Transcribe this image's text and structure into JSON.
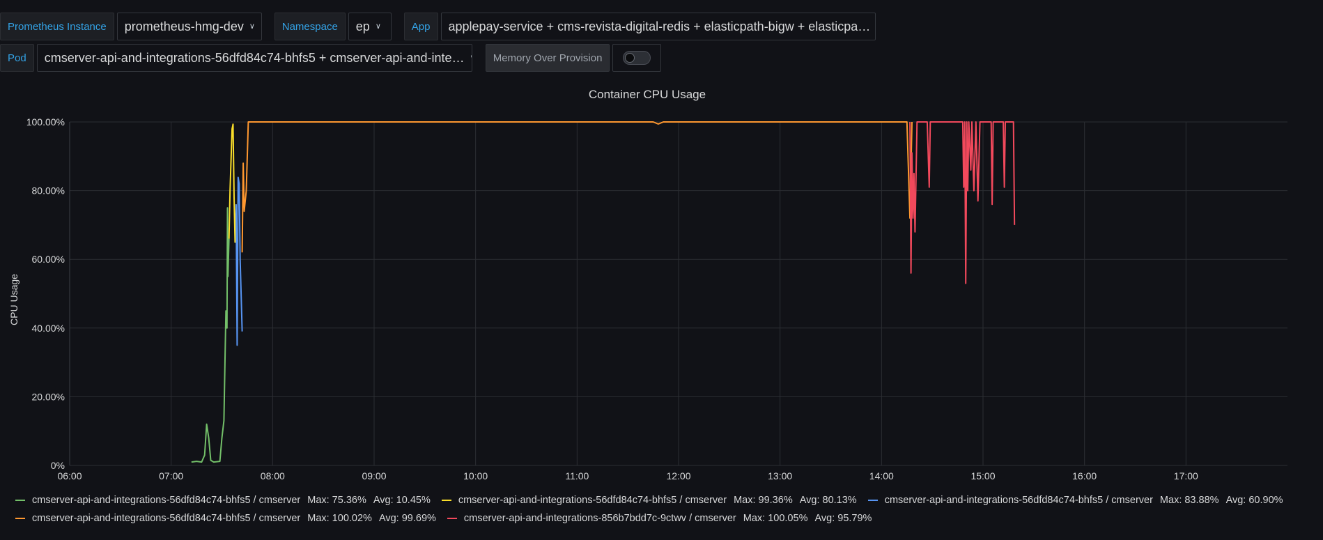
{
  "variables": {
    "prometheus": {
      "label": "Prometheus Instance",
      "value": "prometheus-hmg-dev"
    },
    "namespace": {
      "label": "Namespace",
      "value": "ep"
    },
    "app": {
      "label": "App",
      "value": "applepay-service + cms-revista-digital-redis + elasticpath-bigw + elasticpa…"
    },
    "pod": {
      "label": "Pod",
      "value": "cmserver-api-and-integrations-56dfd84c74-bhfs5 + cmserver-api-and-inte…"
    },
    "memory_over_provision": {
      "label": "Memory Over Provision",
      "enabled": false
    }
  },
  "icons": {
    "dropdown": "chevron-down-icon"
  },
  "chart_data": {
    "type": "line",
    "title": "Container CPU Usage",
    "ylabel": "CPU Usage",
    "xlabel": "",
    "x_unit": "hours (time of day)",
    "xlim": [
      6.0,
      18.0
    ],
    "ylim": [
      0,
      100
    ],
    "x_ticks": [
      "06:00",
      "07:00",
      "08:00",
      "09:00",
      "10:00",
      "11:00",
      "12:00",
      "13:00",
      "14:00",
      "15:00",
      "16:00",
      "17:00"
    ],
    "y_ticks": [
      "0%",
      "20.00%",
      "40.00%",
      "60.00%",
      "80.00%",
      "100.00%"
    ],
    "grid": true,
    "legend_placement": "bottom",
    "series": [
      {
        "name": "cmserver-api-and-integrations-56dfd84c74-bhfs5 / cmserver",
        "max": "Max: 75.36%",
        "avg": "Avg: 10.45%",
        "color": "#73bf69",
        "points": [
          [
            7.2,
            1
          ],
          [
            7.25,
            1.2
          ],
          [
            7.3,
            1
          ],
          [
            7.33,
            3
          ],
          [
            7.35,
            12
          ],
          [
            7.37,
            8
          ],
          [
            7.39,
            1.5
          ],
          [
            7.42,
            1
          ],
          [
            7.48,
            1.2
          ],
          [
            7.5,
            8
          ],
          [
            7.52,
            13
          ],
          [
            7.53,
            30
          ],
          [
            7.54,
            45
          ],
          [
            7.55,
            40
          ],
          [
            7.555,
            75
          ],
          [
            7.56,
            55
          ],
          [
            7.57,
            66
          ]
        ]
      },
      {
        "name": "cmserver-api-and-integrations-56dfd84c74-bhfs5 / cmserver",
        "max": "Max: 99.36%",
        "avg": "Avg: 80.13%",
        "color": "#fade2a",
        "points": [
          [
            7.57,
            66
          ],
          [
            7.58,
            80
          ],
          [
            7.6,
            98
          ],
          [
            7.61,
            99.36
          ],
          [
            7.62,
            78
          ],
          [
            7.63,
            65
          ],
          [
            7.64,
            76
          ]
        ]
      },
      {
        "name": "cmserver-api-and-integrations-56dfd84c74-bhfs5 / cmserver",
        "max": "Max: 83.88%",
        "avg": "Avg: 60.90%",
        "color": "#5794f2",
        "points": [
          [
            7.64,
            76
          ],
          [
            7.65,
            35
          ],
          [
            7.66,
            83.88
          ],
          [
            7.67,
            82
          ],
          [
            7.68,
            60
          ],
          [
            7.7,
            39
          ]
        ]
      },
      {
        "name": "cmserver-api-and-integrations-56dfd84c74-bhfs5 / cmserver",
        "max": "Max: 100.02%",
        "avg": "Avg: 99.69%",
        "color": "#ff9830",
        "points": [
          [
            7.7,
            62
          ],
          [
            7.71,
            88
          ],
          [
            7.72,
            74
          ],
          [
            7.74,
            80
          ],
          [
            7.76,
            100
          ],
          [
            8.0,
            100
          ],
          [
            10.0,
            100
          ],
          [
            11.0,
            100
          ],
          [
            11.75,
            100
          ],
          [
            11.8,
            99.4
          ],
          [
            11.85,
            100
          ],
          [
            13.0,
            100
          ],
          [
            14.0,
            100
          ],
          [
            14.25,
            100
          ],
          [
            14.28,
            72
          ],
          [
            14.3,
            100
          ]
        ]
      },
      {
        "name": "cmserver-api-and-integrations-856b7bdd7c-9ctwv / cmserver",
        "max": "Max: 100.05%",
        "avg": "Avg: 95.79%",
        "color": "#f2495c",
        "points": [
          [
            14.28,
            100
          ],
          [
            14.29,
            56
          ],
          [
            14.3,
            91
          ],
          [
            14.31,
            72
          ],
          [
            14.32,
            85
          ],
          [
            14.33,
            68
          ],
          [
            14.35,
            100
          ],
          [
            14.45,
            100
          ],
          [
            14.47,
            81
          ],
          [
            14.48,
            100
          ],
          [
            14.8,
            100
          ],
          [
            14.81,
            81
          ],
          [
            14.82,
            100
          ],
          [
            14.83,
            53
          ],
          [
            14.84,
            100
          ],
          [
            14.85,
            80
          ],
          [
            14.86,
            100
          ],
          [
            14.88,
            86
          ],
          [
            14.89,
            100
          ],
          [
            14.91,
            80
          ],
          [
            14.93,
            100
          ],
          [
            14.95,
            77
          ],
          [
            14.97,
            100
          ],
          [
            15.08,
            100
          ],
          [
            15.09,
            76
          ],
          [
            15.1,
            100
          ],
          [
            15.2,
            100
          ],
          [
            15.21,
            81
          ],
          [
            15.22,
            100
          ],
          [
            15.3,
            100
          ],
          [
            15.31,
            70
          ]
        ]
      }
    ]
  }
}
